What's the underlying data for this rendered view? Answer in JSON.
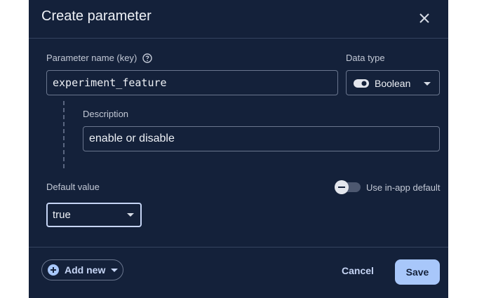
{
  "dialog": {
    "title": "Create parameter"
  },
  "parameter_name": {
    "label": "Parameter name (key)",
    "value": "experiment_feature"
  },
  "data_type": {
    "label": "Data type",
    "selected": "Boolean"
  },
  "description": {
    "label": "Description",
    "value": "enable or disable"
  },
  "default_value": {
    "label": "Default value",
    "selected": "true"
  },
  "use_in_app_default": {
    "label": "Use in-app default",
    "enabled": false
  },
  "footer": {
    "add_new_label": "Add new",
    "cancel_label": "Cancel",
    "save_label": "Save"
  },
  "colors": {
    "dialog_background": "#14213a",
    "primary_accent": "#a8c7fa",
    "focus_border": "#c6d5f5"
  }
}
